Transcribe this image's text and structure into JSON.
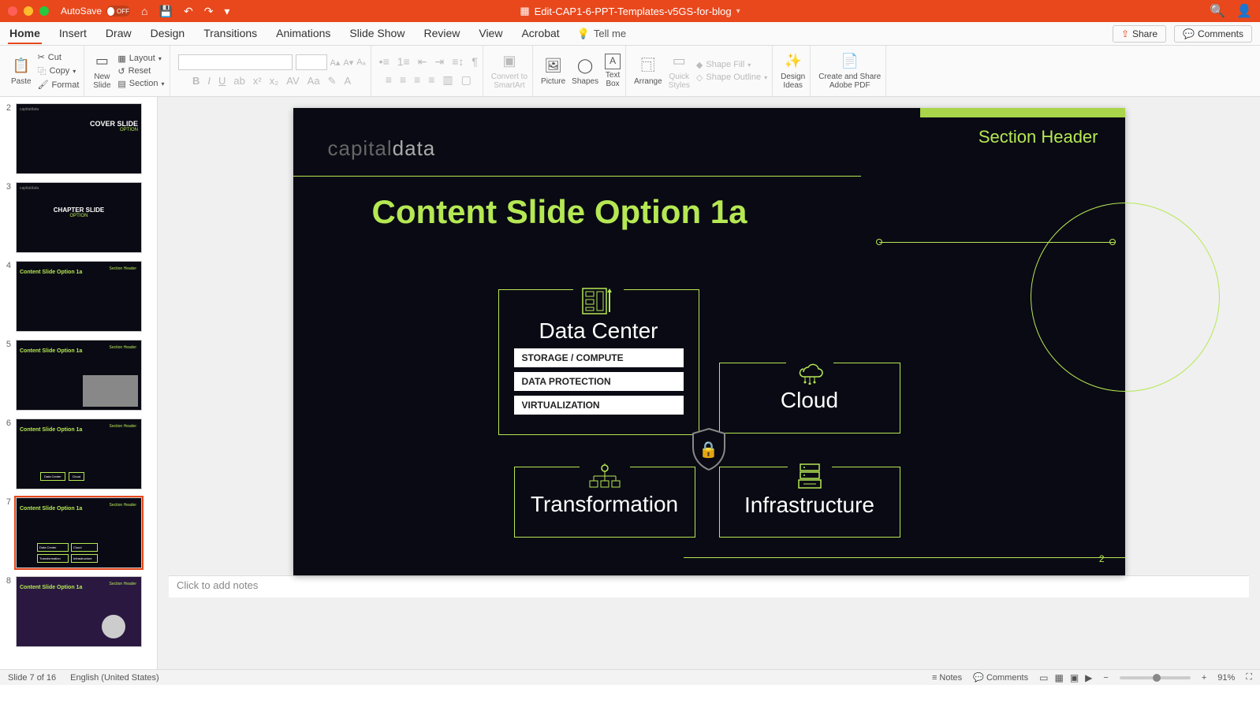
{
  "titlebar": {
    "autosave_label": "AutoSave",
    "autosave_state": "OFF",
    "filename": "Edit-CAP1-6-PPT-Templates-v5GS-for-blog"
  },
  "tabs": {
    "items": [
      "Home",
      "Insert",
      "Draw",
      "Design",
      "Transitions",
      "Animations",
      "Slide Show",
      "Review",
      "View",
      "Acrobat"
    ],
    "active": "Home",
    "tellme": "Tell me",
    "share": "Share",
    "comments": "Comments"
  },
  "ribbon": {
    "paste": "Paste",
    "cut": "Cut",
    "copy": "Copy",
    "format": "Format",
    "new_slide": "New\nSlide",
    "layout": "Layout",
    "reset": "Reset",
    "section": "Section",
    "convert": "Convert to\nSmartArt",
    "picture": "Picture",
    "shapes": "Shapes",
    "textbox": "Text\nBox",
    "arrange": "Arrange",
    "quick_styles": "Quick\nStyles",
    "shape_fill": "Shape Fill",
    "shape_outline": "Shape Outline",
    "design_ideas": "Design\nIdeas",
    "create_pdf": "Create and Share\nAdobe PDF"
  },
  "thumbs": [
    {
      "num": "2",
      "title": "COVER SLIDE",
      "sub": "OPTION"
    },
    {
      "num": "3",
      "title": "CHAPTER SLIDE",
      "sub": "OPTION"
    },
    {
      "num": "4",
      "title": "Content Slide Option 1a"
    },
    {
      "num": "5",
      "title": "Content Slide Option 1a"
    },
    {
      "num": "6",
      "title": "Content Slide Option 1a"
    },
    {
      "num": "7",
      "title": "Content Slide Option 1a",
      "selected": true
    },
    {
      "num": "8",
      "title": "Content Slide Option 1a"
    }
  ],
  "slide": {
    "logo_a": "capital",
    "logo_b": "data",
    "section_header": "Section Header",
    "main_title": "Content Slide Option 1a",
    "dc_title": "Data Center",
    "dc_items": [
      "STORAGE / COMPUTE",
      "DATA PROTECTION",
      "VIRTUALIZATION"
    ],
    "cloud_title": "Cloud",
    "trans_title": "Transformation",
    "infra_title": "Infrastructure",
    "page_num": "2"
  },
  "notes": {
    "placeholder": "Click to add notes"
  },
  "statusbar": {
    "slide_of": "Slide 7 of 16",
    "lang": "English (United States)",
    "notes": "Notes",
    "comments": "Comments",
    "zoom": "91%"
  }
}
